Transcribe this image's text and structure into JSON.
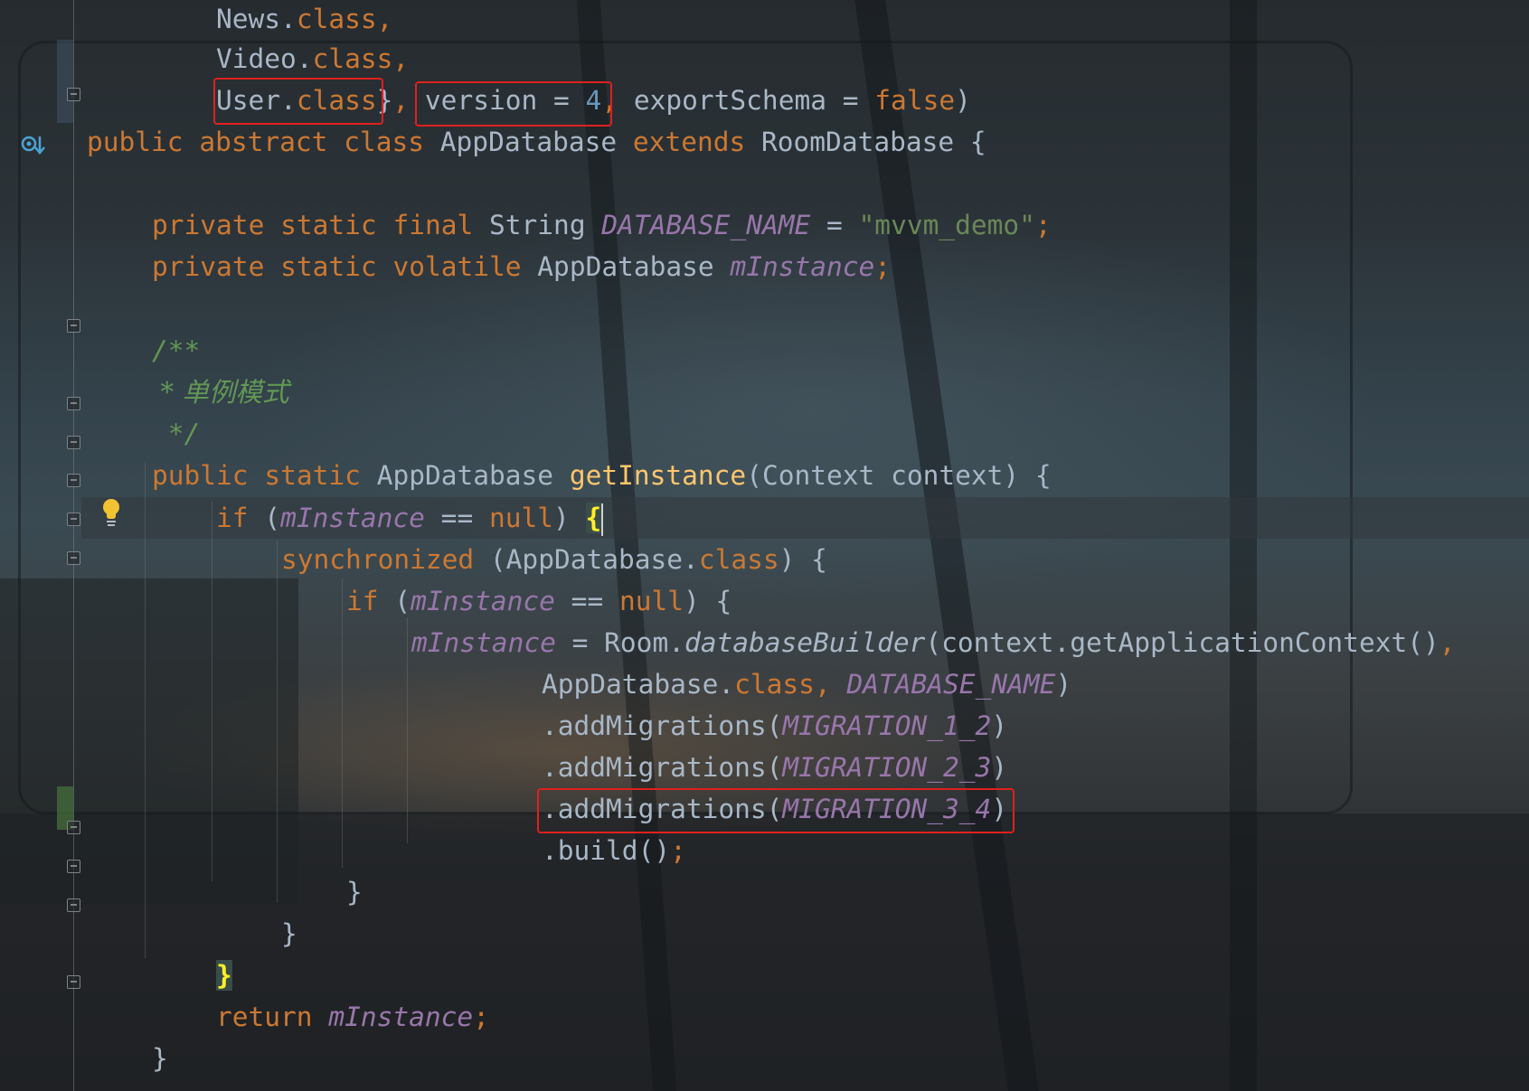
{
  "editor": {
    "language": "Java",
    "theme": "dark",
    "lines": [
      {
        "id": "l1",
        "text": "News.class,"
      },
      {
        "id": "l2",
        "text": "Video.class,"
      },
      {
        "id": "l3",
        "text": "User.class}, version = 4, exportSchema = false)"
      },
      {
        "id": "l4",
        "text": "public abstract class AppDatabase extends RoomDatabase {"
      },
      {
        "id": "l5",
        "text": ""
      },
      {
        "id": "l6",
        "text": "private static final String DATABASE_NAME = \"mvvm_demo\";"
      },
      {
        "id": "l7",
        "text": "private static volatile AppDatabase mInstance;"
      },
      {
        "id": "l8",
        "text": ""
      },
      {
        "id": "l9",
        "text": "/**"
      },
      {
        "id": "l10",
        "text": " * 单例模式"
      },
      {
        "id": "l11",
        "text": " */"
      },
      {
        "id": "l12",
        "text": "public static AppDatabase getInstance(Context context) {"
      },
      {
        "id": "l13",
        "text": "if (mInstance == null) {"
      },
      {
        "id": "l14",
        "text": "synchronized (AppDatabase.class) {"
      },
      {
        "id": "l15",
        "text": "if (mInstance == null) {"
      },
      {
        "id": "l16",
        "text": "mInstance = Room.databaseBuilder(context.getApplicationContext(),"
      },
      {
        "id": "l17",
        "text": "AppDatabase.class, DATABASE_NAME)"
      },
      {
        "id": "l18",
        "text": ".addMigrations(MIGRATION_1_2)"
      },
      {
        "id": "l19",
        "text": ".addMigrations(MIGRATION_2_3)"
      },
      {
        "id": "l20",
        "text": ".addMigrations(MIGRATION_3_4)"
      },
      {
        "id": "l21",
        "text": ".build();"
      },
      {
        "id": "l22",
        "text": "}"
      },
      {
        "id": "l23",
        "text": "}"
      },
      {
        "id": "l24",
        "text": "}"
      },
      {
        "id": "l25",
        "text": "return mInstance;"
      },
      {
        "id": "l26",
        "text": "}"
      }
    ],
    "highlighted_snippets": [
      "User.class",
      "version = 4",
      ".addMigrations(MIGRATION_3_4)"
    ]
  },
  "tokens": {
    "news": "News",
    "video": "Video",
    "user": "User",
    "class_kw": "class",
    "version": "version",
    "version_value": "4",
    "export_schema": "exportSchema",
    "false_kw": "false",
    "public": "public",
    "abstract": "abstract",
    "extends": "extends",
    "app_database": "AppDatabase",
    "room_database": "RoomDatabase",
    "private": "private",
    "static": "static",
    "final": "final",
    "volatile": "volatile",
    "string_type": "String",
    "database_name": "DATABASE_NAME",
    "db_name_value": "\"mvvm_demo\"",
    "m_instance": "mInstance",
    "doc_open": "/**",
    "doc_text": " * 单例模式",
    "doc_close": " */",
    "get_instance": "getInstance",
    "context_type": "Context",
    "context_param": "context",
    "if_kw": "if",
    "null_kw": "null",
    "synchronized_kw": "synchronized",
    "room": "Room",
    "database_builder": "databaseBuilder",
    "get_app_context": "getApplicationContext",
    "add_migrations": ".addMigrations",
    "migration_1_2": "MIGRATION_1_2",
    "migration_2_3": "MIGRATION_2_3",
    "migration_3_4": "MIGRATION_3_4",
    "build": ".build",
    "return_kw": "return"
  },
  "gutter_icons": [
    "implemented-method-icon",
    "lightbulb-intention-icon",
    "fold-marker-icon"
  ],
  "colors": {
    "keyword": "#cc7832",
    "field": "#9876aa",
    "string": "#6a8759",
    "number": "#6897bb",
    "doc_comment": "#629755",
    "method_decl": "#ffc66d",
    "plain": "#a9b7c6",
    "annotation_box": "#e0201c",
    "matched_brace": "#ffef28"
  }
}
